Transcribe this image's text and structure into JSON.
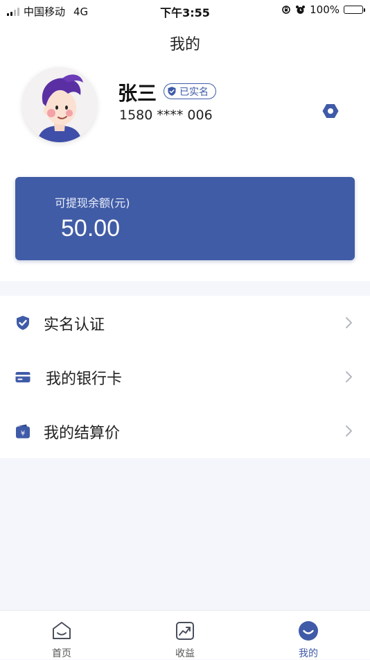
{
  "status_bar": {
    "carrier": "中国移动",
    "network": "4G",
    "time": "下午3:55",
    "battery": "100%"
  },
  "page": {
    "title": "我的"
  },
  "profile": {
    "name": "张三",
    "verified_label": "已实名",
    "phone": "1580 **** 006"
  },
  "balance": {
    "label": "可提现余额(元)",
    "value": "50.00"
  },
  "menu": {
    "items": [
      {
        "label": "实名认证",
        "icon": "shield-check-icon"
      },
      {
        "label": "我的银行卡",
        "icon": "bank-card-icon"
      },
      {
        "label": "我的结算价",
        "icon": "wallet-yuan-icon"
      }
    ]
  },
  "tabbar": {
    "tabs": [
      {
        "label": "首页",
        "icon": "home-icon",
        "active": false
      },
      {
        "label": "收益",
        "icon": "trend-chart-icon",
        "active": false
      },
      {
        "label": "我的",
        "icon": "profile-smile-icon",
        "active": true
      }
    ]
  },
  "colors": {
    "brand": "#415ca6",
    "card": "#415ca6",
    "page_background": "#f4f6fc",
    "tab_active": "#3f5ba8"
  }
}
